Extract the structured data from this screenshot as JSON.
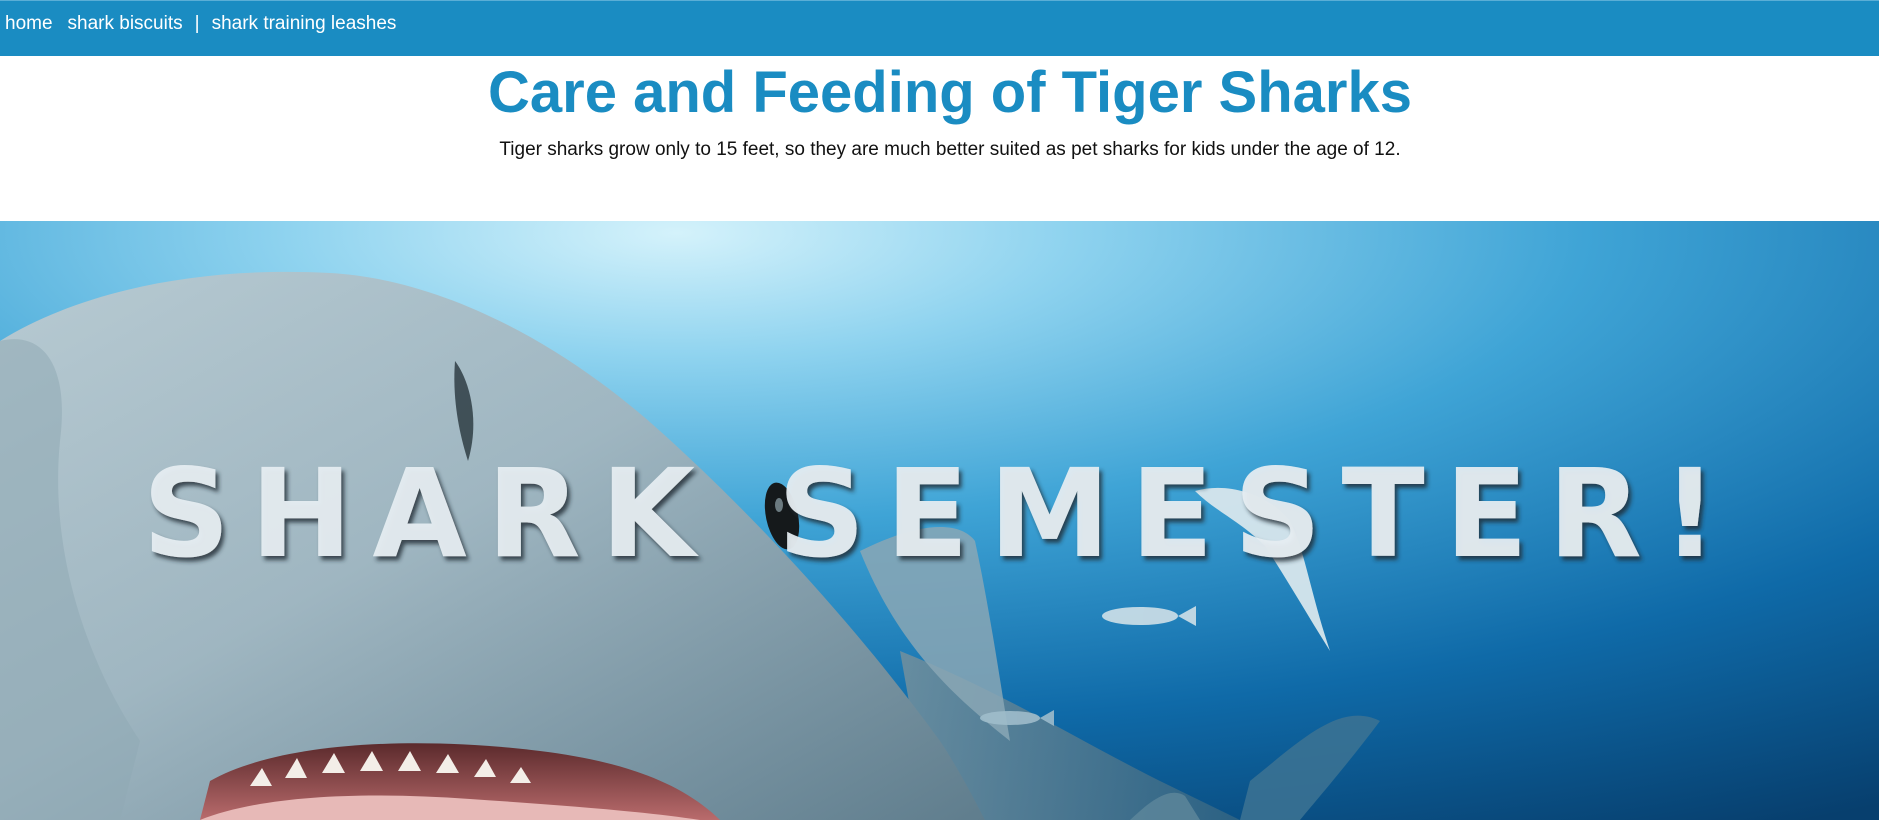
{
  "nav": {
    "items": [
      {
        "label": "home"
      },
      {
        "label": "shark biscuits"
      },
      {
        "label": "shark training leashes"
      }
    ],
    "separator": "|"
  },
  "page": {
    "title": "Care and Feeding of Tiger Sharks",
    "subtitle": "Tiger sharks grow only to 15 feet, so they are much better suited as pet sharks for kids under the age of 12."
  },
  "hero": {
    "overlay_text": "SHARK SEMESTER!"
  },
  "colors": {
    "nav_bg": "#1a8cc2",
    "title": "#1a8cc2",
    "ocean_light": "#a9e0f3",
    "ocean_deep": "#0a4d7e"
  }
}
